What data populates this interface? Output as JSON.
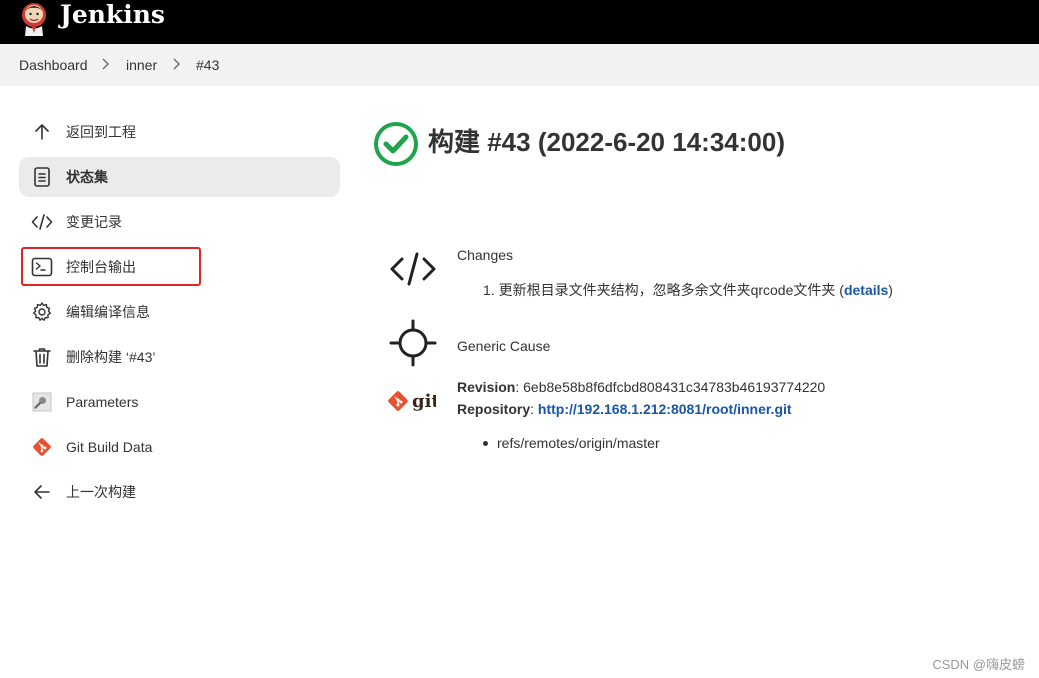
{
  "header": {
    "brand": "Jenkins"
  },
  "breadcrumb": [
    "Dashboard",
    "inner",
    "#43"
  ],
  "sidebar": {
    "items": [
      {
        "label": "返回到工程",
        "icon": "arrow-up-icon",
        "active": false
      },
      {
        "label": "状态集",
        "icon": "document-icon",
        "active": true
      },
      {
        "label": "变更记录",
        "icon": "code-icon",
        "active": false
      },
      {
        "label": "控制台输出",
        "icon": "terminal-icon",
        "active": false
      },
      {
        "label": "编辑编译信息",
        "icon": "gear-icon",
        "active": false
      },
      {
        "label": "删除构建 ‘#43’",
        "icon": "trash-icon",
        "active": false
      },
      {
        "label": "Parameters",
        "icon": "parameters-icon",
        "active": false
      },
      {
        "label": "Git Build Data",
        "icon": "git-icon",
        "active": false
      },
      {
        "label": "上一次构建",
        "icon": "arrow-left-icon",
        "active": false
      }
    ]
  },
  "build": {
    "title": "构建 #43 (2022-6-20 14:34:00)",
    "status_icon": "success-check-icon",
    "status_color": "#1ea54c"
  },
  "changes": {
    "heading": "Changes",
    "items": [
      {
        "number": "1.",
        "text": "更新根目录文件夹结构，忽略多余文件夹qrcode文件夹 (",
        "link": "details",
        "suffix": ")"
      }
    ]
  },
  "cause": {
    "heading": "Generic Cause"
  },
  "git": {
    "logo_text": "git",
    "revision_label": "Revision",
    "revision_value": ": 6eb8e58b8f6dfcbd808431c34783b46193774220",
    "repository_label": "Repository",
    "repository_sep": ": ",
    "repository_url": "http://192.168.1.212:8081/root/inner.git",
    "branches": [
      "refs/remotes/origin/master"
    ]
  },
  "colors": {
    "link": "#1a56a8",
    "highlight": "#e02424",
    "git_orange": "#e9502f"
  },
  "watermark": "CSDN @嗨皮螃"
}
